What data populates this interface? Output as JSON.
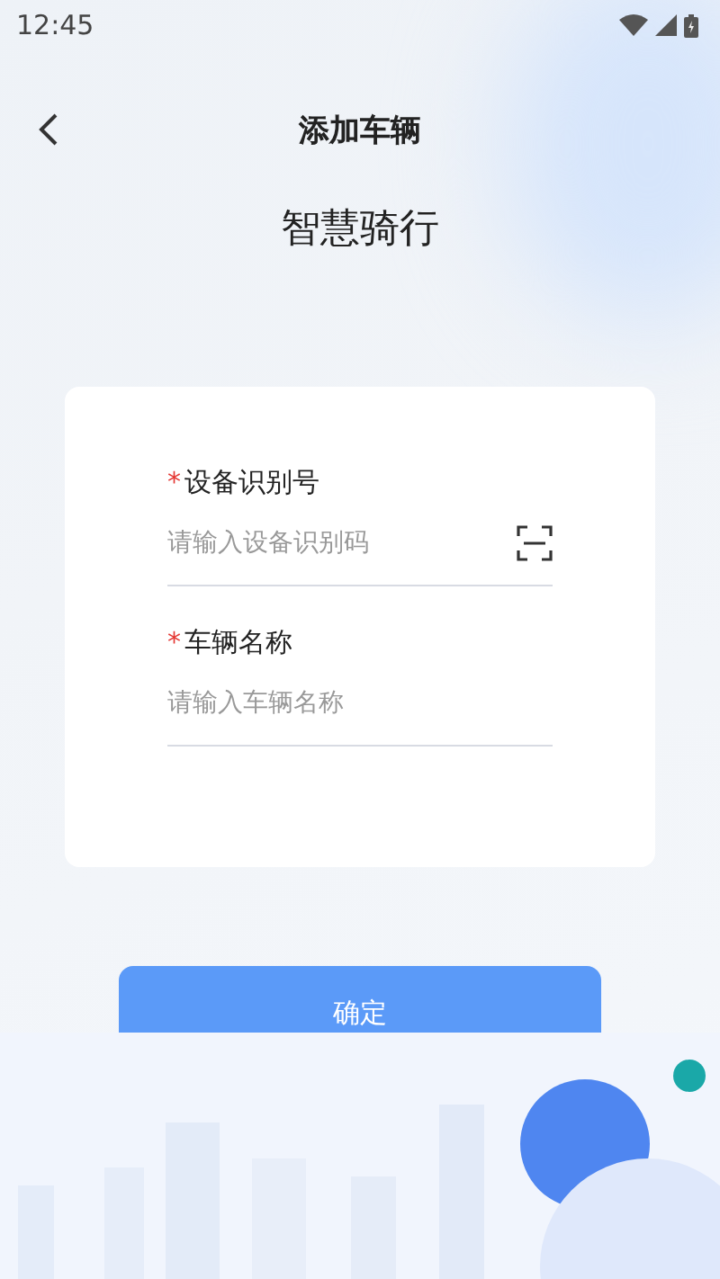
{
  "status_bar": {
    "time": "12:45"
  },
  "header": {
    "title": "添加车辆"
  },
  "brand": "智慧骑行",
  "fields": [
    {
      "kind": "scan",
      "required_mark": "*",
      "label": "设备识别号",
      "placeholder": "请输入设备识别码"
    },
    {
      "kind": "text",
      "required_mark": "*",
      "label": "车辆名称",
      "placeholder": "请输入车辆名称"
    }
  ],
  "confirm_button": "确定"
}
